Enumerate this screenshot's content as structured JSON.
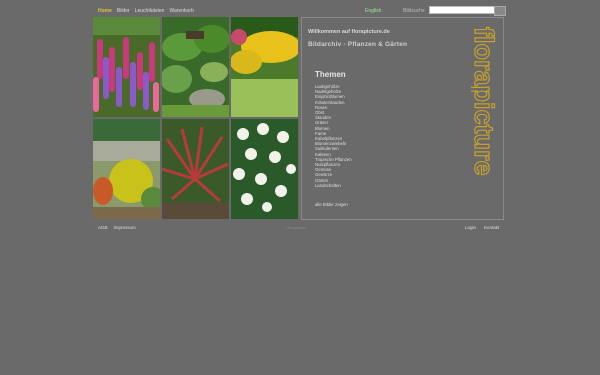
{
  "nav": {
    "items": [
      "Home",
      "Bilder",
      "Leuchtkästen",
      "Warenkorb"
    ],
    "active_index": 0
  },
  "language_link": "English",
  "search": {
    "label": "Bildsuche",
    "placeholder": "",
    "value": ""
  },
  "panel": {
    "welcome": "Willkommen auf florapicture.de",
    "subtitle": "Bildarchiv - Pflanzen & Gärten",
    "brand": "florapicture",
    "themes_title": "Themen",
    "themes": [
      "Laubgehölze",
      "Nadelgehölze",
      "Einjahrsblumen",
      "Kräuterstauden",
      "Rosen",
      "Obst",
      "Stauden",
      "Gräser",
      "Blumen",
      "Farne",
      "Kübelpflanzen",
      "Blumenzwiebeln",
      "Sukkulenten",
      "Kakteen",
      "Tropische Pflanzen",
      "Nutzpflanzen",
      "Gemüse",
      "Gewürze",
      "Gärten",
      "Landschaften"
    ],
    "all_pictures": "alle Bilder zeigen"
  },
  "footer": {
    "left": [
      "AGB",
      "Impressum"
    ],
    "copyright": "© florapicture",
    "right": [
      "Login",
      "Kontakt"
    ]
  },
  "colors": {
    "background": "#6a6a6a",
    "nav_active": "#e3c43a",
    "language_link": "#9fe0a0",
    "brand": "#c8a02a"
  }
}
